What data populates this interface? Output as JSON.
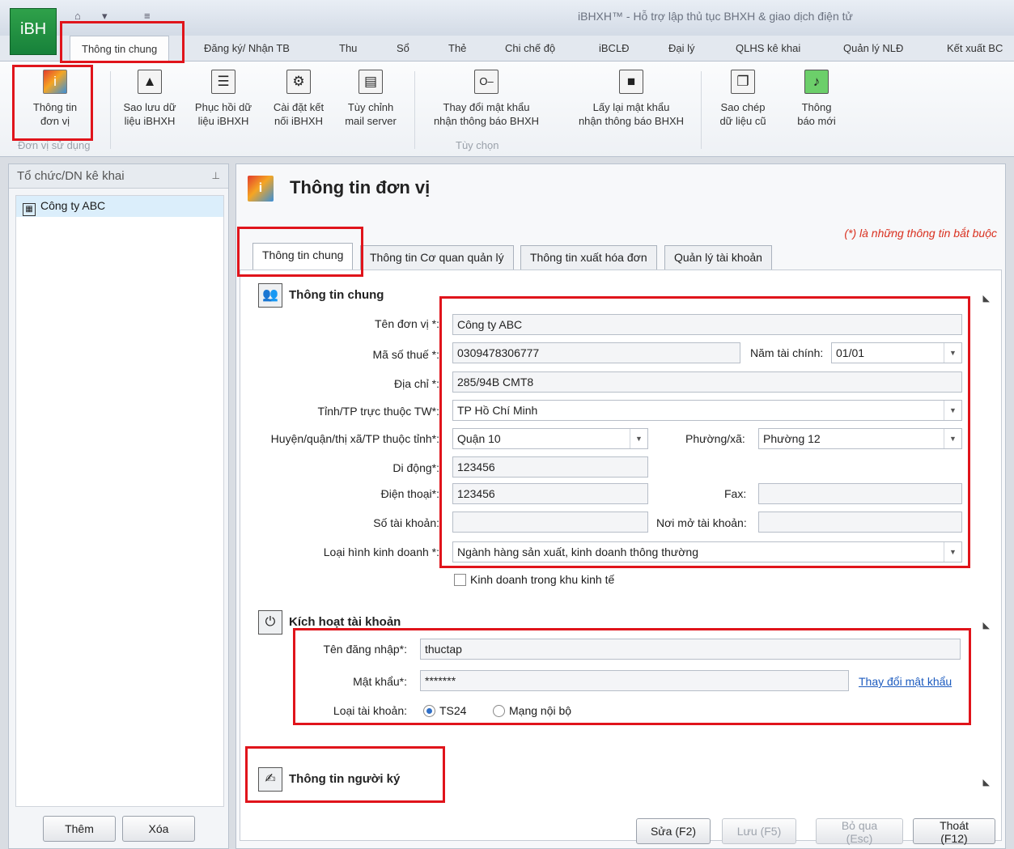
{
  "app": {
    "logo_text": "iBH",
    "window_title": "iBHXH™ - Hỗ trợ lập thủ tục BHXH & giao dịch điện tử",
    "qat_icons": [
      "home-icon",
      "save-icon",
      "menu-icon"
    ]
  },
  "ribbon": {
    "tabs": [
      "Thông tin chung",
      "Đăng ký/ Nhận TB",
      "Thu",
      "Sổ",
      "Thẻ",
      "Chi chế độ",
      "iBCLĐ",
      "Đại lý",
      "QLHS kê khai",
      "Quản lý NLĐ",
      "Kết xuất BC"
    ],
    "active_tab": "Thông tin chung",
    "buttons": [
      {
        "label1": "Thông tin",
        "label2": "đơn vị",
        "icon": "info-icon"
      },
      {
        "label1": "Sao lưu dữ",
        "label2": "liệu iBHXH",
        "icon": "backup-icon"
      },
      {
        "label1": "Phục hồi dữ",
        "label2": "liệu iBHXH",
        "icon": "restore-icon"
      },
      {
        "label1": "Cài đặt kết",
        "label2": "nối iBHXH",
        "icon": "gear-icon"
      },
      {
        "label1": "Tùy chỉnh",
        "label2": "mail server",
        "icon": "mail-server-icon"
      },
      {
        "label1": "Thay đổi mật khẩu",
        "label2": "nhận thông báo BHXH",
        "icon": "key-icon"
      },
      {
        "label1": "Lấy lại mật khẩu",
        "label2": "nhận thông báo BHXH",
        "icon": "lock-icon"
      },
      {
        "label1": "Sao chép",
        "label2": "dữ liệu cũ",
        "icon": "copy-icon"
      },
      {
        "label1": "Thông",
        "label2": "báo mới",
        "icon": "bell-icon"
      }
    ],
    "groups": [
      "Đơn vị sử dụng",
      "Tùy chọn"
    ]
  },
  "left_panel": {
    "title": "Tổ chức/DN kê khai",
    "items": [
      "Công ty ABC"
    ],
    "add_label": "Thêm",
    "delete_label": "Xóa"
  },
  "main": {
    "title": "Thông tin đơn vị",
    "required_note": "(*) là những thông tin bắt buộc",
    "tabs": [
      "Thông tin chung",
      "Thông tin Cơ quan quản lý",
      "Thông tin xuất hóa đơn",
      "Quản lý tài khoản"
    ],
    "active_tab": "Thông tin chung",
    "general": {
      "section_title": "Thông tin chung",
      "unit_name_label": "Tên đơn vị *:",
      "unit_name": "Công ty ABC",
      "tax_code_label": "Mã số thuế *:",
      "tax_code": "0309478306777",
      "fiscal_year_label": "Năm tài chính:",
      "fiscal_year": "01/01",
      "address_label": "Địa chỉ *:",
      "address": "285/94B CMT8",
      "province_label": "Tỉnh/TP trực thuộc TW*:",
      "province": "TP Hồ Chí Minh",
      "district_label": "Huyện/quận/thị xã/TP thuộc tỉnh*:",
      "district": "Quận 10",
      "ward_label": "Phường/xã:",
      "ward": "Phường 12",
      "mobile_label": "Di động*:",
      "mobile": "123456",
      "phone_label": "Điện thoại*:",
      "phone": "123456",
      "fax_label": "Fax:",
      "fax": "",
      "account_no_label": "Số tài khoản:",
      "account_no": "",
      "bank_label": "Nơi mở tài khoản:",
      "bank": "",
      "business_type_label": "Loại hình kinh doanh *:",
      "business_type": "Ngành hàng sản xuất, kinh doanh thông thường",
      "economic_zone_label": "Kinh doanh trong khu kinh tế"
    },
    "activation": {
      "section_title": "Kích hoạt tài khoản",
      "username_label": "Tên đăng nhập*:",
      "username": "thuctap",
      "password_label": "Mật khẩu*:",
      "password": "*******",
      "change_password_link": "Thay đổi mật khẩu",
      "account_type_label": "Loại tài khoản:",
      "account_type_options": [
        "TS24",
        "Mạng nội bộ"
      ],
      "account_type_selected": "TS24"
    },
    "signer": {
      "section_title": "Thông tin người ký"
    },
    "buttons": {
      "edit": "Sửa (F2)",
      "save": "Lưu (F5)",
      "skip": "Bỏ qua (Esc)",
      "exit": "Thoát (F12)"
    }
  },
  "colors": {
    "highlight": "#e0141b",
    "required_note": "#d9301f",
    "link": "#1c5bbf",
    "logo_green": "#2fa14a"
  }
}
